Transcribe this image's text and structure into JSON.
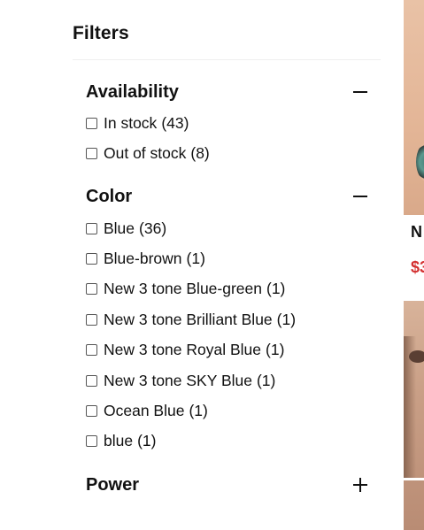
{
  "filters": {
    "title": "Filters",
    "groups": [
      {
        "label": "Availability",
        "expanded": true,
        "toggle_icon": "minus-icon",
        "options": [
          {
            "label": "In stock",
            "count": "(43)",
            "checked": false
          },
          {
            "label": "Out of stock",
            "count": "(8)",
            "checked": false
          }
        ]
      },
      {
        "label": "Color",
        "expanded": true,
        "toggle_icon": "minus-icon",
        "options": [
          {
            "label": "Blue",
            "count": "(36)",
            "checked": false
          },
          {
            "label": "Blue-brown",
            "count": "(1)",
            "checked": false
          },
          {
            "label": "New 3 tone Blue-green",
            "count": "(1)",
            "checked": false
          },
          {
            "label": "New 3 tone Brilliant Blue",
            "count": "(1)",
            "checked": false
          },
          {
            "label": "New 3 tone Royal Blue",
            "count": "(1)",
            "checked": false
          },
          {
            "label": "New 3 tone SKY Blue",
            "count": "(1)",
            "checked": false
          },
          {
            "label": "Ocean Blue",
            "count": "(1)",
            "checked": false
          },
          {
            "label": "blue",
            "count": "(1)",
            "checked": false
          }
        ]
      },
      {
        "label": "Power",
        "expanded": false,
        "toggle_icon": "plus-icon",
        "options": []
      }
    ]
  },
  "products_peek": {
    "name_fragment": "N",
    "price_fragment": "$3",
    "price_color": "#d32f2f"
  }
}
